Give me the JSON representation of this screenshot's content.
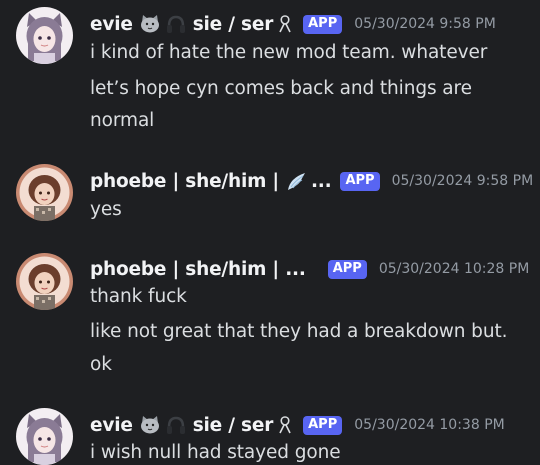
{
  "messages": [
    {
      "username_a": "evie",
      "username_b": "sie / ser",
      "badge": "APP",
      "timestamp": "05/30/2024 9:58 PM",
      "lines": [
        "i kind of hate the new mod team. whatever",
        "let’s hope cyn comes back and things are",
        "normal"
      ]
    },
    {
      "username": "phoebe | she/him |",
      "username_tail": "...",
      "badge": "APP",
      "timestamp": "05/30/2024 9:58 PM",
      "lines": [
        "yes"
      ]
    },
    {
      "username": "phoebe | she/him | ...",
      "badge": "APP",
      "timestamp": "05/30/2024 10:28 PM",
      "lines": [
        "thank fuck",
        "like not great that they had a breakdown but.",
        "ok"
      ]
    },
    {
      "username_a": "evie",
      "username_b": "sie / ser",
      "badge": "APP",
      "timestamp": "05/30/2024 10:38 PM",
      "lines": [
        "i wish null had stayed gone"
      ]
    }
  ],
  "icons": {
    "cat": "cat-face-icon",
    "headphones": "headphones-icon",
    "ribbon": "awareness-ribbon-icon",
    "wing": "wing-icon"
  },
  "colors": {
    "background": "#1e1f22",
    "username": "#f2f3f5",
    "text": "#dbdee1",
    "timestamp": "#949ba4",
    "badge": "#5865f2"
  }
}
